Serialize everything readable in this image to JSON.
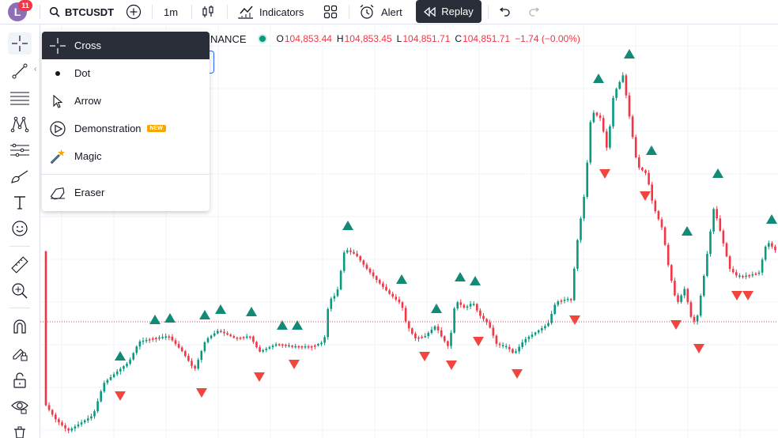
{
  "toolbar": {
    "avatar_letter": "L",
    "notifications": "11",
    "symbol": "BTCUSDT",
    "interval": "1m",
    "indicators": "Indicators",
    "alert": "Alert",
    "replay": "Replay"
  },
  "drawing_menu": {
    "items": [
      {
        "label": "Cross",
        "icon": "cross-icon",
        "selected": true
      },
      {
        "label": "Dot",
        "icon": "dot-icon"
      },
      {
        "label": "Arrow",
        "icon": "arrow-cursor-icon"
      },
      {
        "label": "Demonstration",
        "icon": "demonstration-icon",
        "badge": "NEW"
      },
      {
        "label": "Magic",
        "icon": "magic-wand-icon"
      },
      {
        "label": "Eraser",
        "icon": "eraser-icon"
      }
    ]
  },
  "legend": {
    "exchange": "NANCE",
    "open_key": "O",
    "open": "104,853.44",
    "high_key": "H",
    "high": "104,853.45",
    "low_key": "L",
    "low": "104,851.71",
    "close_key": "C",
    "close": "104,851.71",
    "change": "−1.74 (−0.00%)"
  },
  "colors": {
    "up": "#089981",
    "down": "#f23645",
    "up_marker": "#138a76",
    "down_marker": "#f2453d",
    "grid": "#f0f3fa",
    "price_line": "#f23645"
  },
  "chart_data": {
    "type": "candlestick",
    "series": [
      {
        "name": "buy_signals",
        "marker": "triangle-up"
      },
      {
        "name": "sell_signals",
        "marker": "triangle-down"
      }
    ],
    "last_price": 104851.71
  }
}
